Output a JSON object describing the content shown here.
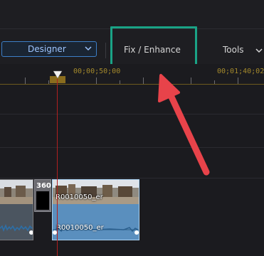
{
  "toolbar": {
    "designer_label": "Designer",
    "fix_enhance_label": "Fix / Enhance",
    "tools_label": "Tools"
  },
  "timeline": {
    "ruler_times": [
      "00;00;50;00",
      "00;01;40;02"
    ],
    "clips": [
      {
        "name": "R0010050_er",
        "audio_name": "R0010050_er"
      }
    ],
    "badge_360": "360"
  },
  "colors": {
    "highlight": "#1aa386",
    "arrow": "#e8434a",
    "playhead": "#b02020",
    "selected_clip": "#6aa3d4"
  }
}
